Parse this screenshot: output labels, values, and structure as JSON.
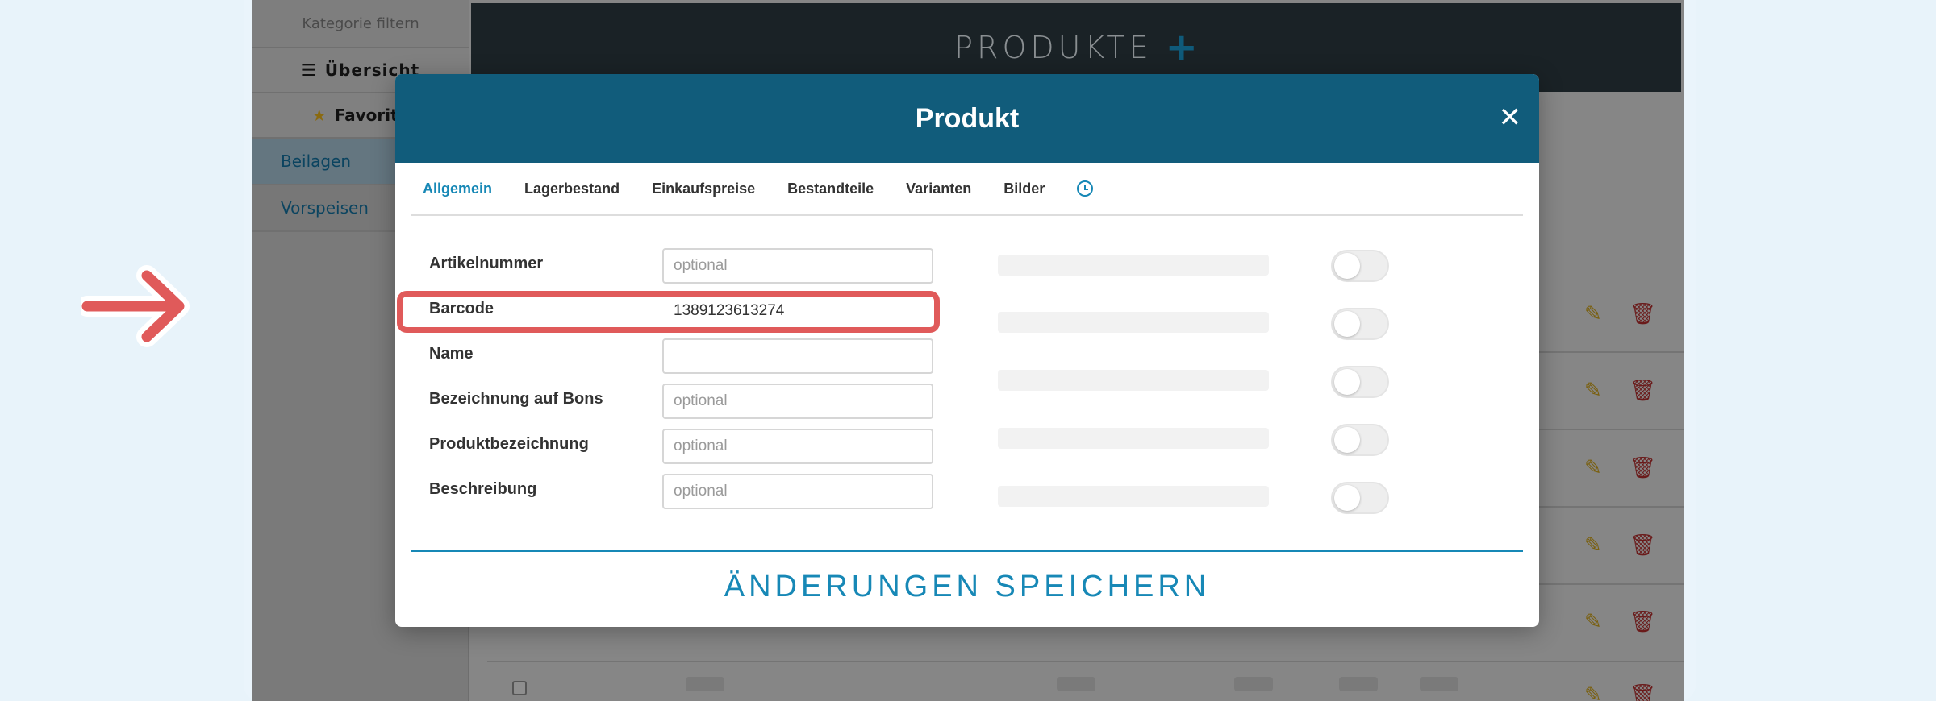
{
  "sidebar": {
    "filter_label": "Kategorie filtern",
    "overview_label": "Übersicht",
    "favorites_label": "Favorite",
    "categories": [
      "Beilagen",
      "Vorspeisen"
    ]
  },
  "header": {
    "title": "PRODUKTE"
  },
  "modal": {
    "title": "Produkt",
    "tabs": [
      "Allgemein",
      "Lagerbestand",
      "Einkaufspreise",
      "Bestandteile",
      "Varianten",
      "Bilder"
    ],
    "fields": [
      {
        "label": "Artikelnummer",
        "value": "",
        "placeholder": "optional"
      },
      {
        "label": "Barcode",
        "value": "1389123613274",
        "placeholder": ""
      },
      {
        "label": "Name",
        "value": "",
        "placeholder": ""
      },
      {
        "label": "Bezeichnung auf Bons",
        "value": "",
        "placeholder": "optional"
      },
      {
        "label": "Produktbezeichnung",
        "value": "",
        "placeholder": "optional"
      },
      {
        "label": "Beschreibung",
        "value": "",
        "placeholder": "optional"
      }
    ],
    "save_label": "ÄNDERUNGEN SPEICHERN"
  },
  "colors": {
    "accent": "#1788b6",
    "modal_header": "#115c7b",
    "highlight": "#e05a5a"
  },
  "icons": {
    "arrow": "arrow-right-icon",
    "close": "close-icon",
    "history": "clock-icon",
    "edit": "pencil-icon",
    "delete": "trash-icon"
  }
}
